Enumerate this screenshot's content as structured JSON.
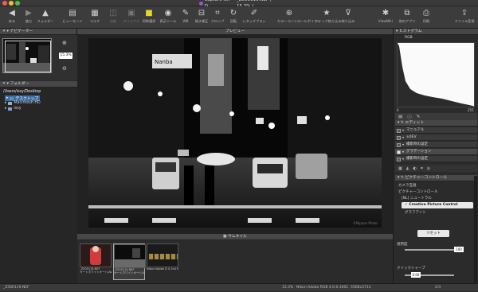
{
  "window": {
    "title": "Capture NX-D",
    "file_title": "_Z500119.NEF ( 15.3% )"
  },
  "toolbar": {
    "buttons": [
      {
        "label": "戻る",
        "icon": "back-arrow"
      },
      {
        "label": "進む",
        "icon": "forward-arrow"
      },
      {
        "label": "フォルダー",
        "icon": "folder-up"
      },
      {
        "label": "ビューモード",
        "icon": "view-mode"
      },
      {
        "label": "マルチ",
        "icon": "multi-view"
      },
      {
        "label": "比較",
        "icon": "compare"
      },
      {
        "label": "オリジナル",
        "icon": "original"
      },
      {
        "label": "同時選択",
        "icon": "sync-select"
      },
      {
        "label": "表示ツール",
        "icon": "display-tool"
      },
      {
        "label": "WB",
        "icon": "wb-dropper"
      },
      {
        "label": "傾き補正",
        "icon": "straighten"
      },
      {
        "label": "クロップ",
        "icon": "crop"
      },
      {
        "label": "回転",
        "icon": "rotate"
      },
      {
        "label": "レタッチブラシ",
        "icon": "retouch-brush"
      },
      {
        "label": "カラーコントロールポイント",
        "icon": "color-control-point"
      },
      {
        "label": "クイック絞り込み",
        "icon": "star"
      },
      {
        "label": "絞り込み",
        "icon": "filter"
      },
      {
        "label": "ViewNX-i",
        "icon": "viewnx"
      },
      {
        "label": "他のアプリ",
        "icon": "open-with"
      },
      {
        "label": "印刷",
        "icon": "print"
      },
      {
        "label": "ファイル変換",
        "icon": "convert"
      }
    ]
  },
  "navigator": {
    "title": "ナビゲーター",
    "zoom": "15.3%"
  },
  "folders": {
    "title": "フォルダー",
    "path": "/Users/issy/Desktop",
    "items": [
      "デスクトップ",
      "Macintosh HD",
      "issy"
    ]
  },
  "preview": {
    "title": "プレビュー",
    "sign_text": "Nanba",
    "watermark": "©Nippon Photo"
  },
  "thumbnails": {
    "title": "サムネイル",
    "items": [
      {
        "name": "_Z500119.NEF",
        "info": "オートホワイトオート(AWB) 350 …"
      },
      {
        "name": "_Z500119.NEF",
        "info": "オートホワイトオート(AWB) …"
      },
      {
        "name": "",
        "info": "Nikon Adobe D 0.1mi Moderate…"
      }
    ]
  },
  "histogram": {
    "title": "ヒストグラム",
    "channel": "RGB",
    "min": "0",
    "max": "255"
  },
  "edit": {
    "title": "エディット",
    "items": [
      "マニュアル",
      "±0EV",
      "撮影時の設定",
      "グラデーション",
      "撮影時の設定"
    ]
  },
  "picture_control": {
    "title": "ピクチャーコントロール",
    "mode": "カメラ互換",
    "label": "ピクチャーコントロール",
    "base": "[NL] ニュートラル",
    "preset": "Creative Picture Control",
    "sub": "グラフアイト",
    "reset": "リセット",
    "strength_label": "適用度",
    "strength_value": "100",
    "sharp_label": "クイックシャープ",
    "sharp_value": "0.00"
  },
  "status": {
    "left": "_Z500119.NEF",
    "zoom": "15.3%",
    "profile": "Nikon Adobe RGB 4.0.0.3001",
    "size": "5568x3712",
    "page": "2/3"
  }
}
